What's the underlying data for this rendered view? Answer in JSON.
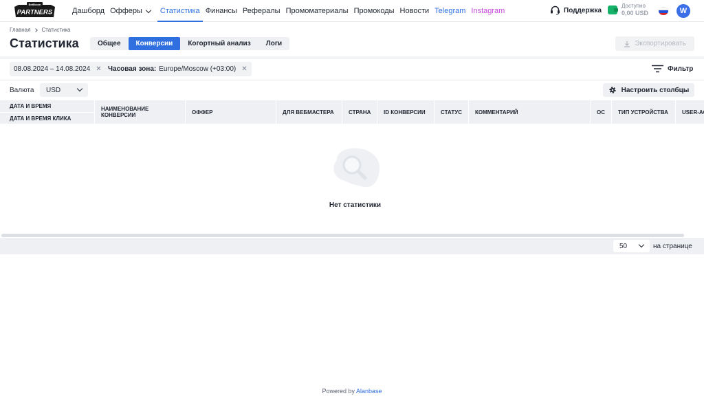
{
  "nav": {
    "logo_text_top": "BetBoom",
    "logo_text_main": "PARTNERS",
    "links": [
      {
        "label": "Дашборд"
      },
      {
        "label": "Офферы"
      },
      {
        "label": "Статистика"
      },
      {
        "label": "Финансы"
      },
      {
        "label": "Рефералы"
      },
      {
        "label": "Промоматериалы"
      },
      {
        "label": "Промокоды"
      },
      {
        "label": "Новости"
      },
      {
        "label": "Telegram"
      },
      {
        "label": "Instagram"
      }
    ],
    "support_label": "Поддержка",
    "balance_label": "Доступно",
    "balance_amount": "0,00 USD",
    "avatar_letter": "W"
  },
  "breadcrumb": {
    "home": "Главная",
    "current": "Статистика"
  },
  "page": {
    "title": "Статистика",
    "tabs": [
      {
        "label": "Общее"
      },
      {
        "label": "Конверсии"
      },
      {
        "label": "Когортный анализ"
      },
      {
        "label": "Логи"
      }
    ],
    "export_label": "Экспортировать"
  },
  "filters": {
    "date_range": "08.08.2024 – 14.08.2024",
    "timezone_label": "Часовая зона:",
    "timezone_value": "Europe/Moscow (+03:00)",
    "filter_label": "Фильтр"
  },
  "currency": {
    "label": "Валюта",
    "value": "USD"
  },
  "columns_button": "Настроить столбцы",
  "table": {
    "headers": {
      "datetime": "ДАТА И ВРЕМЯ",
      "click_datetime": "ДАТА И ВРЕМЯ КЛИКА",
      "conversion_name_1": "НАИМЕНОВАНИЕ",
      "conversion_name_2": "КОНВЕРСИИ",
      "offer": "ОФФЕР",
      "webmaster": "ДЛЯ ВЕБМАСТЕРА",
      "country": "СТРАНА",
      "conversion_id": "ID КОНВЕРСИИ",
      "status": "СТАТУС",
      "comment": "КОММЕНТАРИЙ",
      "os": "ОС",
      "device_type": "ТИП УСТРОЙСТВА",
      "user_agent": "USER-AG"
    },
    "empty_text": "Нет статистики"
  },
  "pagination": {
    "per_page_value": "50",
    "per_page_label": "на странице"
  },
  "footer": {
    "powered_by": "Powered by",
    "brand": "Alanbase"
  },
  "colors": {
    "accent": "#2f6fe0",
    "instagram": "#c24ad8",
    "wallet": "#17b26a",
    "header_bg": "#eef0f3"
  }
}
